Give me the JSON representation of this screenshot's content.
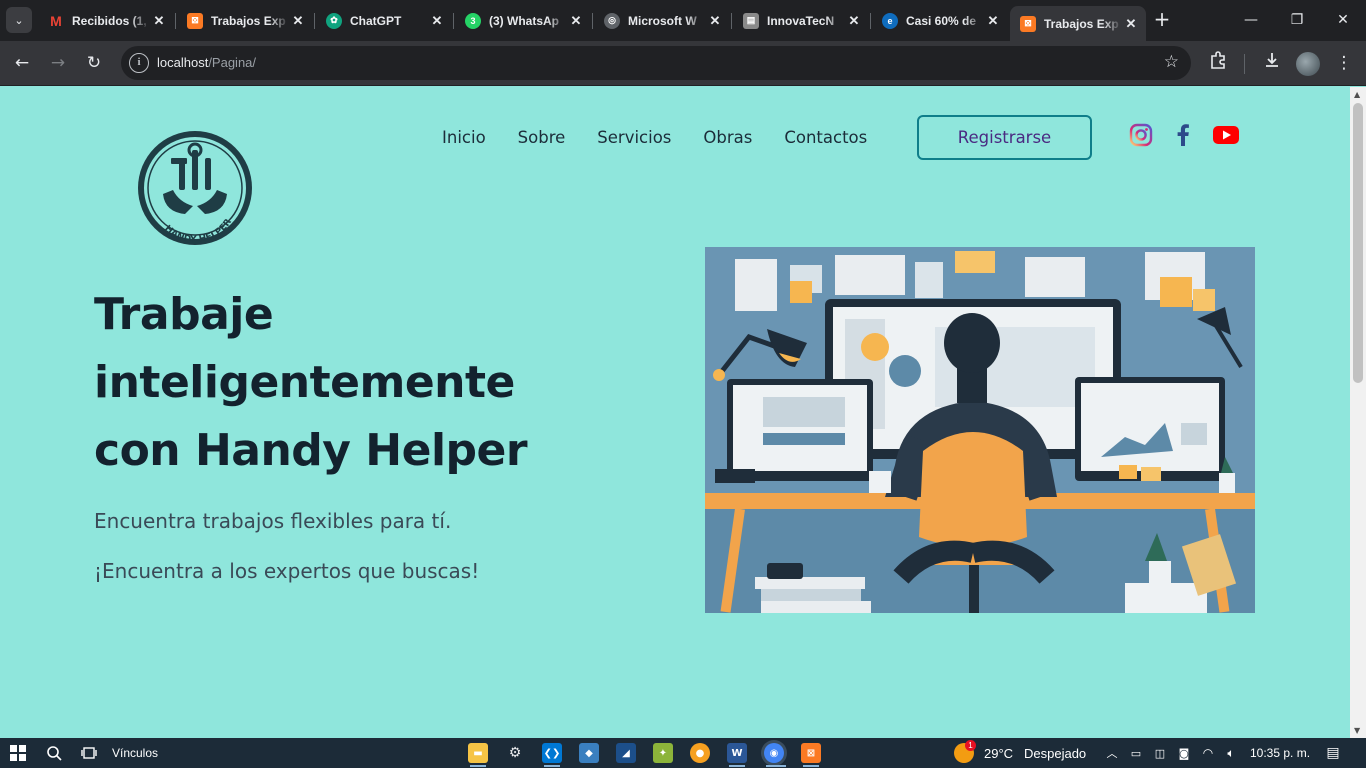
{
  "browser": {
    "tabs": [
      {
        "title": "Recibidos (1,",
        "icon": "gmail-icon",
        "color": "#ea4335"
      },
      {
        "title": "Trabajos Exp",
        "icon": "xampp-icon",
        "color": "#fb7a24"
      },
      {
        "title": "ChatGPT",
        "icon": "chatgpt-icon",
        "color": "#10a37f"
      },
      {
        "title": "(3) WhatsAp",
        "icon": "whatsapp-icon",
        "color": "#25d366"
      },
      {
        "title": "Microsoft W",
        "icon": "globe-icon",
        "color": "#5f6368"
      },
      {
        "title": "InnovaTecN",
        "icon": "page-icon",
        "color": "#8a8a8a"
      },
      {
        "title": "Casi 60% de",
        "icon": "edge-icon",
        "color": "#0f6cbd"
      },
      {
        "title": "Trabajos Exp",
        "icon": "xampp-icon",
        "color": "#fb7a24",
        "active": true
      }
    ],
    "address": {
      "host": "localhost",
      "path": "/Pagina/"
    }
  },
  "page": {
    "nav": [
      "Inicio",
      "Sobre",
      "Servicios",
      "Obras",
      "Contactos"
    ],
    "register_label": "Registrarse",
    "logo_text": "HANDY HELPER",
    "hero": {
      "title_lines": [
        "Trabaje",
        "inteligentemente",
        "con Handy Helper"
      ],
      "subtitle_1": "Encuentra trabajos flexibles para tí.",
      "subtitle_2": "¡Encuentra a los expertos que buscas!"
    },
    "social": [
      "instagram-icon",
      "facebook-icon",
      "youtube-icon"
    ],
    "colors": {
      "background": "#8fe6dc",
      "accent": "#0f7e8a",
      "text": "#13222e"
    }
  },
  "taskbar": {
    "search_label": "Vínculos",
    "weather": {
      "temp": "29°C",
      "status": "Despejado",
      "badge": "1"
    },
    "clock": "10:35 p. m."
  }
}
